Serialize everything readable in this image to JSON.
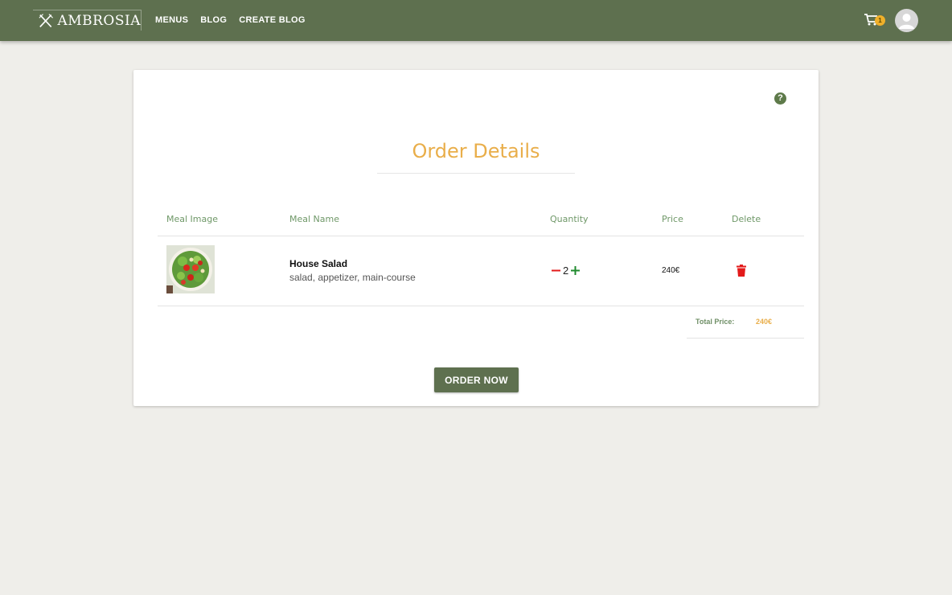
{
  "header": {
    "logo_text": "AMBROSIA",
    "nav": [
      "MENUS",
      "BLOG",
      "CREATE BLOG"
    ],
    "cart_count": "1",
    "cart_icon": "shopping-cart-icon",
    "avatar_icon": "user-avatar-icon"
  },
  "order": {
    "title": "Order Details",
    "help_icon": "question-icon",
    "help_label": "?",
    "columns": [
      "Meal Image",
      "Meal Name",
      "Quantity",
      "Price",
      "Delete"
    ],
    "items": [
      {
        "name": "House Salad",
        "tags": "salad, appetizer, main-course",
        "quantity": "2",
        "price": "240€",
        "image_icon": "salad-image"
      }
    ],
    "total_label": "Total Price:",
    "total_value": "240€",
    "order_button": "ORDER NOW"
  },
  "colors": {
    "brand_green": "#5e704f",
    "accent_orange": "#e9ae4a",
    "delete_red": "#e31a1a",
    "plus_green": "#1f8a2e"
  }
}
